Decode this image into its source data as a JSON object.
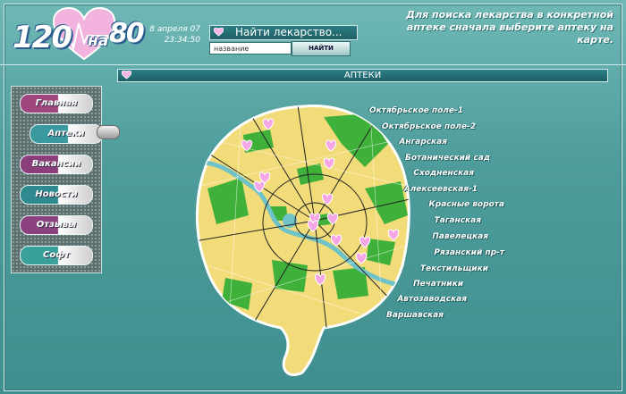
{
  "header": {
    "logo": {
      "part1": "120",
      "part2": "на",
      "part3": "80"
    },
    "date": "8 апреля 07",
    "time": "23:34:50",
    "search_title": "Найти лекарство...",
    "search_placeholder": "название",
    "search_button": "НАЙТИ",
    "hint": "Для поиска лекарства в конкретной аптеке сначала выберите аптеку на карте."
  },
  "section_title": "АПТЕКИ",
  "menu": [
    {
      "label": "Главная",
      "color": "#a0457e",
      "active": false
    },
    {
      "label": "Аптеки",
      "color": "#3a9aa0",
      "active": true
    },
    {
      "label": "Вакансии",
      "color": "#8a3e7a",
      "active": false
    },
    {
      "label": "Новости",
      "color": "#2f8a90",
      "active": false
    },
    {
      "label": "Отзывы",
      "color": "#8c4281",
      "active": false
    },
    {
      "label": "Софт",
      "color": "#3aa09c",
      "active": false
    }
  ],
  "districts": [
    "Октябрьское поле-1",
    "Октябрьское поле-2",
    "Ангарская",
    "Ботанический сад",
    "Сходненская",
    "Алексеевская-1",
    "Красные ворота",
    "Таганская",
    "Павелецкая",
    "Рязанский пр-т",
    "Текстильщики",
    "Печатники",
    "Автозаводская",
    "Варшавская"
  ],
  "colors": {
    "background": "#4e9d9c",
    "map_land": "#f2dc7a",
    "map_green": "#3fb13a",
    "map_water": "#6fc3c8",
    "marker": "#f4a6e6"
  }
}
